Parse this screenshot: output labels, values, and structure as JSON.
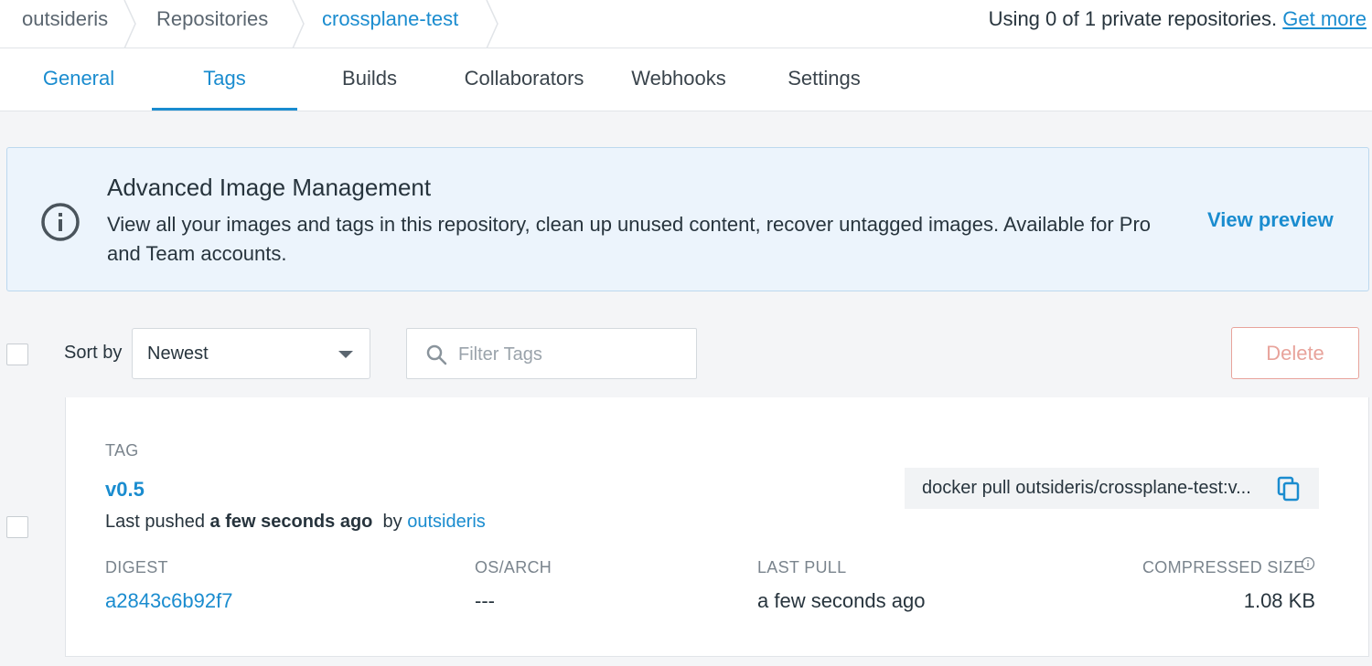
{
  "breadcrumb": {
    "items": [
      "outsideris",
      "Repositories",
      "crossplane-test"
    ],
    "usage_text": "Using 0 of 1 private repositories.",
    "usage_link": "Get more"
  },
  "tabs": [
    "General",
    "Tags",
    "Builds",
    "Collaborators",
    "Webhooks",
    "Settings"
  ],
  "active_tab": "Tags",
  "banner": {
    "icon": "info-circle-icon",
    "title": "Advanced Image Management",
    "text": "View all your images and tags in this repository, clean up unused content, recover untagged images. Available for Pro and Team accounts.",
    "link": "View preview"
  },
  "controls": {
    "sort_label": "Sort by",
    "sort_value": "Newest",
    "filter_placeholder": "Filter Tags",
    "delete_label": "Delete"
  },
  "tag": {
    "section_label": "TAG",
    "name": "v0.5",
    "pushed_prefix": "Last pushed",
    "pushed_time": "a few seconds ago",
    "by_label": "by",
    "pushed_by": "outsideris",
    "pull_command": "docker pull outsideris/crossplane-test:v...",
    "columns": {
      "digest_label": "DIGEST",
      "osarch_label": "OS/ARCH",
      "lastpull_label": "LAST PULL",
      "size_label": "COMPRESSED SIZE"
    },
    "digest": "a2843c6b92f7",
    "os_arch": "---",
    "last_pull": "a few seconds ago",
    "compressed_size": "1.08 KB"
  },
  "colors": {
    "accent": "#1a8ccf",
    "danger": "#e8a39b",
    "banner_bg": "#ecf4fc"
  }
}
